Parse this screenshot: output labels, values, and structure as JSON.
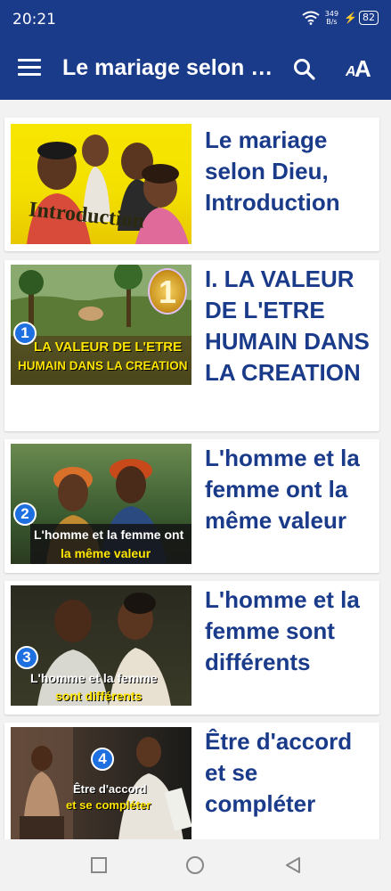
{
  "status_bar": {
    "time": "20:21",
    "net_speed_value": "349",
    "net_speed_unit": "B/s",
    "battery": "82",
    "icons": [
      "wifi-icon",
      "charging-icon",
      "battery-icon"
    ]
  },
  "app_bar": {
    "title": "Le mariage selon Dieu, Introduction",
    "font_size_label_small": "A",
    "font_size_label_big": "A",
    "icons": [
      "menu-icon",
      "search-icon",
      "font-size-icon"
    ]
  },
  "colors": {
    "primary": "#1a3a8a",
    "title_text": "#1a3a8a",
    "badge": "#1e6fe0",
    "caption_yellow": "#ffe600"
  },
  "articles": [
    {
      "title": "Le mariage selon Dieu, Introduction",
      "thumb_caption": "Introduction",
      "thumb_number": ""
    },
    {
      "title": "I. LA VALEUR DE L'ETRE HUMAIN DANS LA CREATION",
      "thumb_caption_line1": "LA VALEUR DE L'ETRE",
      "thumb_caption_line2": "HUMAIN DANS LA CREATION",
      "thumb_number": "1",
      "thumb_big_number": "1"
    },
    {
      "title": "L'homme et la femme ont la même valeur",
      "thumb_caption_line1": "L'homme et la femme ont",
      "thumb_caption_line2": "la même valeur",
      "thumb_number": "2"
    },
    {
      "title": "L'homme et la femme sont différents",
      "thumb_caption_line1": "L'homme et la femme",
      "thumb_caption_line2": "sont différents",
      "thumb_number": "3"
    },
    {
      "title": "Être d'accord et se compléter",
      "thumb_caption_line1": "Être d'accord",
      "thumb_caption_line2": "et se compléter",
      "thumb_number": "4"
    }
  ],
  "nav_bar": {
    "icons": [
      "recents-icon",
      "home-icon",
      "back-icon"
    ]
  }
}
